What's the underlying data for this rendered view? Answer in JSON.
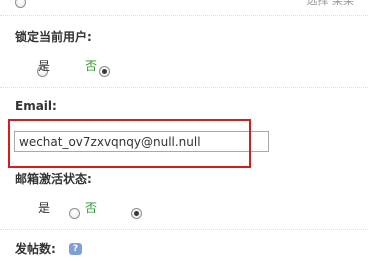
{
  "top": {
    "option_partial_text": "选择 某某"
  },
  "lock_user": {
    "label": "锁定当前用户:",
    "options": [
      {
        "label": "是",
        "checked": false
      },
      {
        "label": "否",
        "checked": true
      }
    ]
  },
  "email": {
    "label": "Email:",
    "value": "wechat_ov7zxvqnqy@null.null"
  },
  "email_status": {
    "label": "邮箱激活状态:",
    "options": [
      {
        "label": "是",
        "checked": false
      },
      {
        "label": "否",
        "checked": true
      }
    ]
  },
  "post_count": {
    "label": "发帖数:",
    "help_icon_text": "?"
  },
  "colors": {
    "highlight_border": "#d01f1f",
    "option_no_text": "#2a9a2a",
    "help_icon_bg": "#7f9fd8"
  }
}
